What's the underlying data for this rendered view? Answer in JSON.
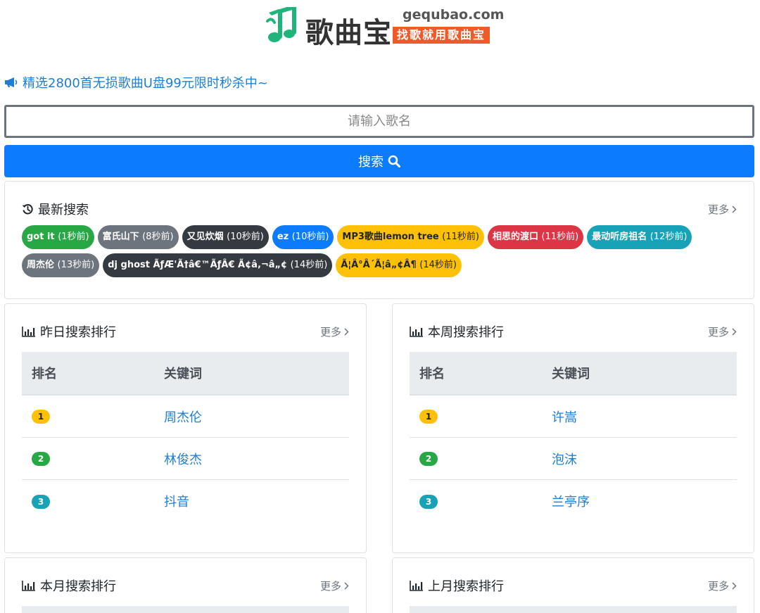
{
  "logo": {
    "title": "歌曲宝",
    "domain": "gequbao.com",
    "slogan": "找歌就用歌曲宝"
  },
  "notice": {
    "text": "精选2800首无损歌曲U盘99元限时秒杀中~",
    "icon": "megaphone-icon"
  },
  "search": {
    "placeholder": "请输入歌名",
    "button_label": "搜索"
  },
  "recent": {
    "title": "最新搜索",
    "more": "更多",
    "tags": [
      {
        "text": "got it",
        "ago": "(1秒前)",
        "color": "#28a745",
        "fg": "#fff"
      },
      {
        "text": "富氏山下",
        "ago": "(8秒前)",
        "color": "#6c757d",
        "fg": "#fff"
      },
      {
        "text": "又见炊烟",
        "ago": "(10秒前)",
        "color": "#343a40",
        "fg": "#fff"
      },
      {
        "text": "ez",
        "ago": "(10秒前)",
        "color": "#0d7bfe",
        "fg": "#fff"
      },
      {
        "text": "MP3歌曲lemon tree",
        "ago": "(11秒前)",
        "color": "#ffc107",
        "fg": "#212529"
      },
      {
        "text": "相思的渡口",
        "ago": "(11秒前)",
        "color": "#dc3545",
        "fg": "#fff"
      },
      {
        "text": "最动听房祖名",
        "ago": "(12秒前)",
        "color": "#17a2b8",
        "fg": "#fff"
      },
      {
        "text": "周杰伦",
        "ago": "(13秒前)",
        "color": "#6c757d",
        "fg": "#fff"
      },
      {
        "text": "dj ghost ÃƒÆ'Ã†â€™ÃƒÂ€ Ã¢â‚¬â„¢",
        "ago": "(14秒前)",
        "color": "#343a40",
        "fg": "#fff"
      },
      {
        "text": "Ã¦Â°Â´Ã¦â„¢Â¶",
        "ago": "(14秒前)",
        "color": "#ffc107",
        "fg": "#212529"
      }
    ]
  },
  "rank_headers": {
    "rank": "排名",
    "keyword": "关键词"
  },
  "rank_colors": [
    "#ffc107",
    "#28a745",
    "#17a2b8"
  ],
  "yesterday": {
    "title": "昨日搜索排行",
    "more": "更多",
    "rows": [
      {
        "rank": "1",
        "kw": "周杰伦"
      },
      {
        "rank": "2",
        "kw": "林俊杰"
      },
      {
        "rank": "3",
        "kw": "抖音"
      }
    ]
  },
  "week": {
    "title": "本周搜索排行",
    "more": "更多",
    "rows": [
      {
        "rank": "1",
        "kw": "许嵩"
      },
      {
        "rank": "2",
        "kw": "泡沫"
      },
      {
        "rank": "3",
        "kw": "兰亭序"
      }
    ]
  },
  "month": {
    "title": "本月搜索排行",
    "more": "更多"
  },
  "lastmonth": {
    "title": "上月搜索排行",
    "more": "更多"
  }
}
